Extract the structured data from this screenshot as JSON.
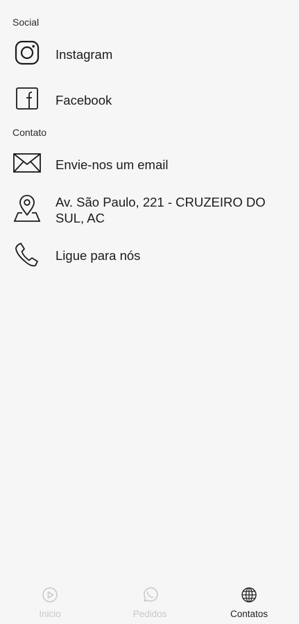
{
  "sections": {
    "social": {
      "title": "Social",
      "items": [
        {
          "label": "Instagram",
          "icon": "instagram-icon"
        },
        {
          "label": "Facebook",
          "icon": "facebook-icon"
        }
      ]
    },
    "contact": {
      "title": "Contato",
      "items": [
        {
          "label": "Envie-nos um email",
          "icon": "envelope-icon"
        },
        {
          "label": "Av. São Paulo, 221 - CRUZEIRO DO SUL, AC",
          "icon": "map-pin-icon"
        },
        {
          "label": "Ligue para nós",
          "icon": "phone-icon"
        }
      ]
    }
  },
  "tabbar": {
    "tabs": [
      {
        "label": "Inicio",
        "icon": "play-circle-icon",
        "active": false
      },
      {
        "label": "Pedidos",
        "icon": "whatsapp-icon",
        "active": false
      },
      {
        "label": "Contatos",
        "icon": "globe-icon",
        "active": true
      }
    ]
  },
  "colors": {
    "background": "#f6f6f6",
    "text": "#1b1b1b",
    "inactive_tab": "#c8c8c8"
  }
}
